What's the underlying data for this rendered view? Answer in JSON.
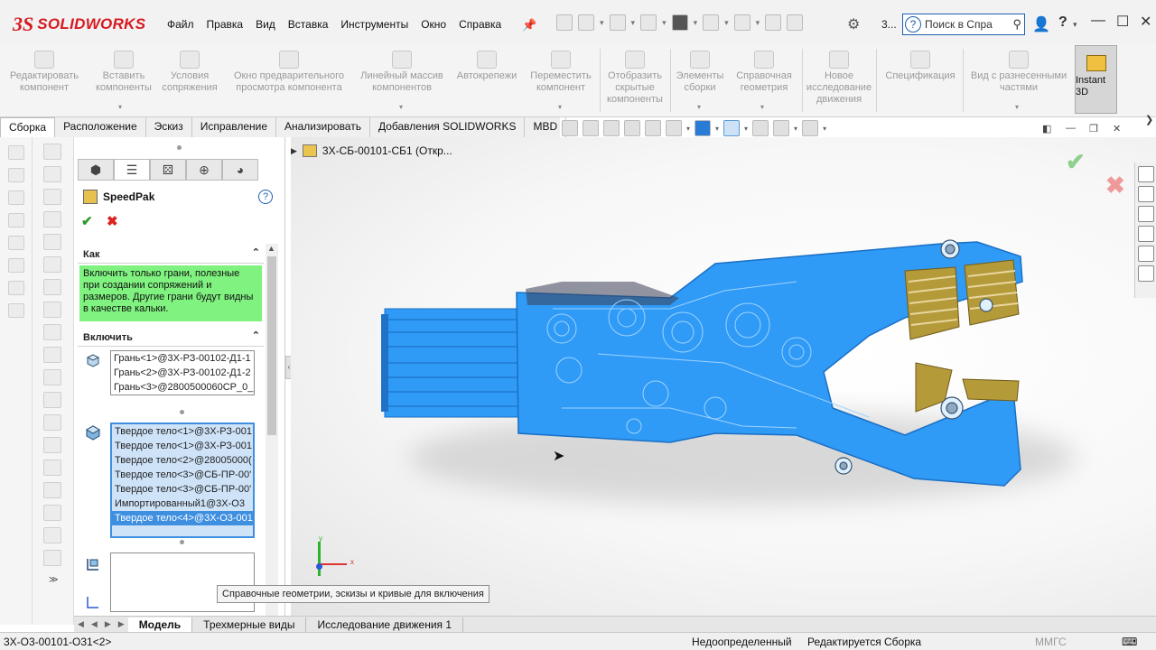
{
  "app": {
    "logo_mark": "3S",
    "logo_text": "SOLIDWORKS"
  },
  "menu": [
    "Файл",
    "Правка",
    "Вид",
    "Вставка",
    "Инструменты",
    "Окно",
    "Справка"
  ],
  "toolbar": {
    "gear_num": "3...",
    "search_placeholder": "Поиск в Спра"
  },
  "ribbon": {
    "buttons": [
      "Редактировать компонент",
      "Вставить компоненты",
      "Условия сопряжения",
      "Окно предварительного просмотра компонента",
      "Линейный массив компонентов",
      "Автокрепежи",
      "Переместить компонент",
      "Отобразить скрытые компоненты",
      "Элементы сборки",
      "Справочная геометрия",
      "Новое исследование движения",
      "Спецификация",
      "Вид с разнесенными частями"
    ],
    "instant3d": "Instant 3D"
  },
  "tabs": [
    "Сборка",
    "Расположение",
    "Эскиз",
    "Исправление",
    "Анализировать",
    "Добавления SOLIDWORKS",
    "MBD"
  ],
  "pm": {
    "title": "SpeedPak",
    "help": "?",
    "ok": "✔",
    "cancel": "✖",
    "section_how": "Как",
    "message": "Включить только грани, полезные при создании сопряжений и размеров.  Другие грани будут видны в качестве кальки.",
    "section_include": "Включить",
    "faces": [
      "Грань<1>@3Х-РЗ-00102-Д1-1",
      "Грань<2>@3Х-РЗ-00102-Д1-2",
      "Грань<3>@2800500060СР_0_"
    ],
    "bodies": [
      "Твердое тело<1>@3Х-РЗ-001",
      "Твердое тело<1>@3Х-РЗ-001",
      "Твердое тело<2>@28005000(",
      "Твердое тело<3>@СБ-ПР-00'",
      "Твердое тело<3>@СБ-ПР-00'",
      "Импортированный1@3Х-О3",
      "Твердое тело<4>@3Х-О3-001"
    ]
  },
  "graphics": {
    "tree_root": "3Х-СБ-00101-СБ1  (Откр...",
    "tooltip": "Справочные геометрии, эскизы и кривые для включения",
    "triad_x": "x",
    "triad_y": "y"
  },
  "bottom_tabs": [
    "Модель",
    "Трехмерные виды",
    "Исследование движения 1"
  ],
  "status": {
    "left": "3Х-О3-00101-О31<2>",
    "state": "Недоопределенный",
    "mode": "Редактируется Сборка",
    "units": "ММГС"
  },
  "colors": {
    "model_blue": "#2f9bf6",
    "message_green": "#7ff27f",
    "brand_red": "#d71920"
  }
}
